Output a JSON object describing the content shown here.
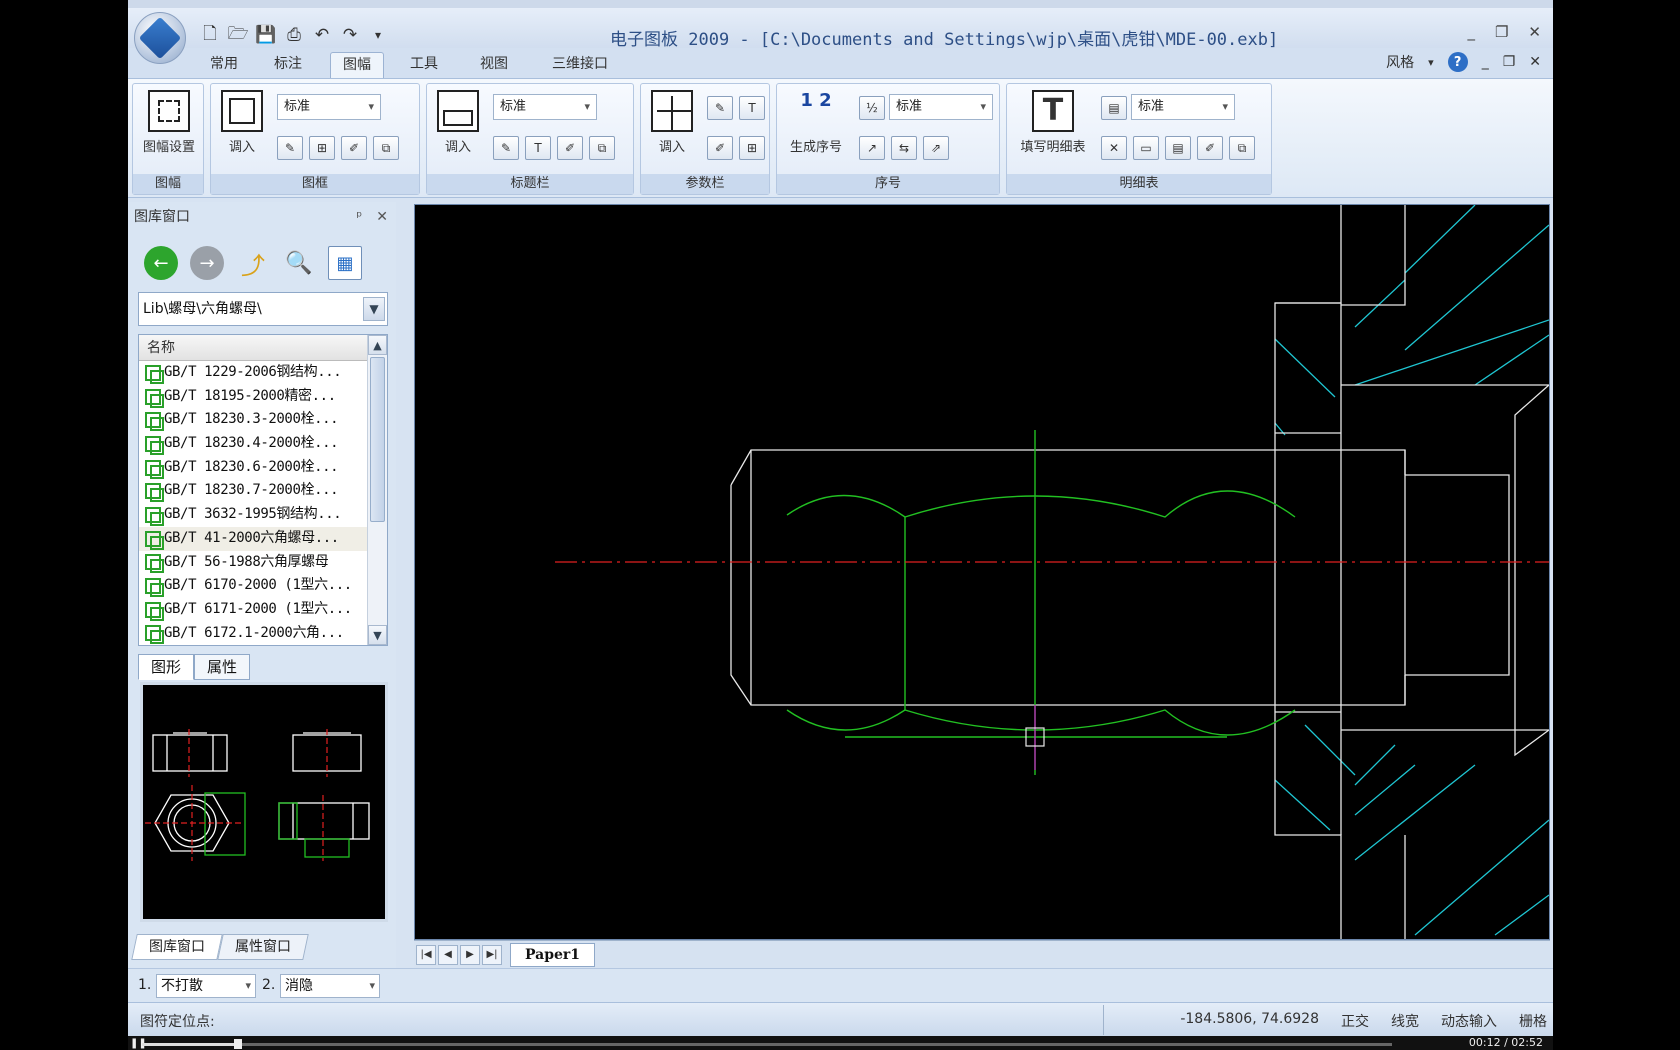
{
  "window": {
    "title": "电子图板 2009 - [C:\\Documents and Settings\\wjp\\桌面\\虎钳\\MDE-00.exb]",
    "controls": [
      "_",
      "❐",
      "✕"
    ]
  },
  "ribbon_tabs": [
    "常用",
    "标注",
    "图幅",
    "工具",
    "视图",
    "三维接口"
  ],
  "active_tab": "图幅",
  "style_menu": {
    "label": "风格",
    "help": "?"
  },
  "ribbon": {
    "groups": {
      "frame_group": {
        "label": "图幅",
        "btn": "图幅设置"
      },
      "border_group": {
        "label": "图框",
        "btn": "调入",
        "combo": "标准"
      },
      "titleblock_group": {
        "label": "标题栏",
        "btn": "调入",
        "combo": "标准"
      },
      "param_group": {
        "label": "参数栏",
        "btn": "调入"
      },
      "seq_group": {
        "label": "序号",
        "btn": "生成序号",
        "combo": "标准",
        "num": "1 2"
      },
      "detail_group": {
        "label": "明细表",
        "btn": "填写明细表",
        "combo": "标准"
      }
    }
  },
  "library_panel": {
    "title": "图库窗口",
    "pin": "ᵖ",
    "close": "✕",
    "path": "Lib\\螺母\\六角螺母\\",
    "column_header": "名称",
    "items": [
      "GB/T 1229-2006钢结构...",
      "GB/T 18195-2000精密...",
      "GB/T 18230.3-2000栓...",
      "GB/T 18230.4-2000栓...",
      "GB/T 18230.6-2000栓...",
      "GB/T 18230.7-2000栓...",
      "GB/T 3632-1995钢结构...",
      "GB/T 41-2000六角螺母...",
      "GB/T 56-1988六角厚螺母",
      "GB/T 6170-2000 (1型六...",
      "GB/T 6171-2000 (1型六...",
      "GB/T 6172.1-2000六角..."
    ],
    "selected_index": 7,
    "subtabs": [
      "图形",
      "属性"
    ],
    "bottom_tabs": [
      "图库窗口",
      "属性窗口"
    ]
  },
  "sheet": {
    "tab": "Paper1"
  },
  "options": {
    "opt1_label": "1.",
    "opt1_value": "不打散",
    "opt2_label": "2.",
    "opt2_value": "消隐"
  },
  "status": {
    "prompt": "图符定位点:",
    "coords": "-184.5806, 74.6928",
    "modes": [
      "正交",
      "线宽",
      "动态输入",
      "栅格"
    ]
  },
  "video": {
    "time": "00:12 / 02:52",
    "progress": 0.077
  }
}
